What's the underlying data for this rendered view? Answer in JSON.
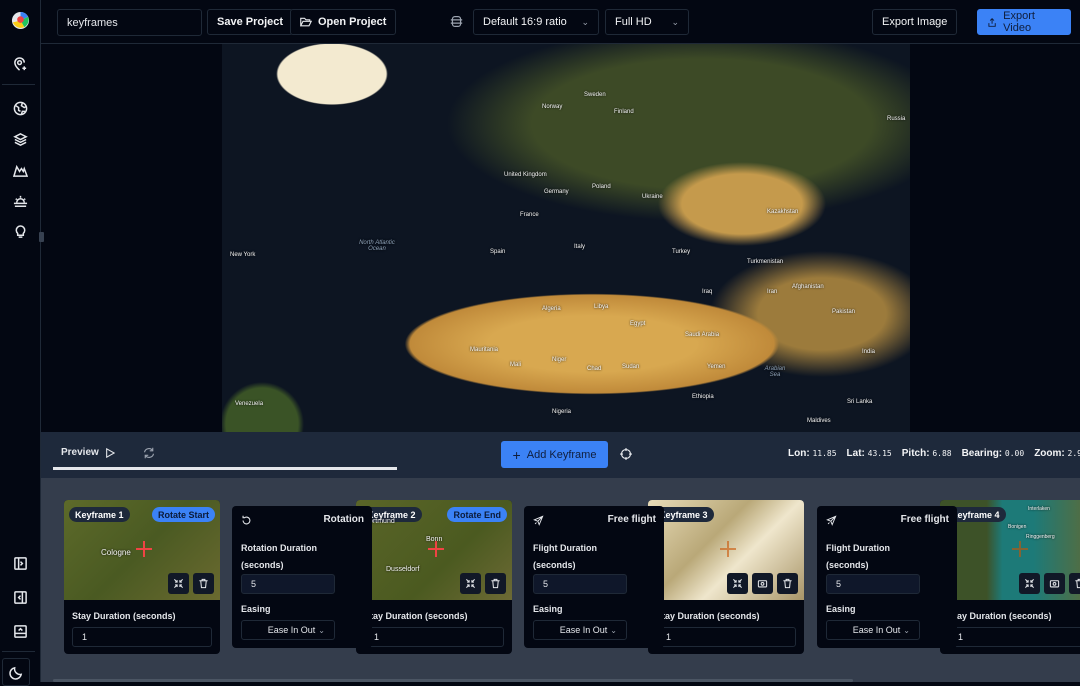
{
  "topbar": {
    "project_name": "keyframes",
    "save_label": "Save Project",
    "open_label": "Open Project",
    "ratio": "Default 16:9 ratio",
    "resolution": "Full HD",
    "export_image": "Export Image",
    "export_video": "Export Video"
  },
  "sidebar": {
    "icons": [
      "logo",
      "add-location-icon",
      "globe-icon",
      "layers-icon",
      "terrain-icon",
      "sunrise-icon",
      "lightbulb-icon",
      "panel-right-icon",
      "panel-left-icon",
      "panel-bottom-icon",
      "moon-icon"
    ]
  },
  "map": {
    "labels": [
      "Finland",
      "Sweden",
      "Norway",
      "Russia",
      "United Kingdom",
      "Germany",
      "France",
      "Spain",
      "Italy",
      "Poland",
      "Ukraine",
      "Turkey",
      "Kazakhstan",
      "Iran",
      "Egypt",
      "Libya",
      "Algeria",
      "Mali",
      "Niger",
      "Chad",
      "Sudan",
      "Saudi Arabia",
      "Pakistan",
      "India",
      "Afghanistan",
      "Nigeria",
      "Ethiopia",
      "Venezuela",
      "New York",
      "Turkmenistan",
      "Yemen",
      "Iraq",
      "Mauritania",
      "Sri Lanka",
      "Maldives"
    ],
    "ocean": "North Atlantic Ocean",
    "sea": "Arabian Sea"
  },
  "controls": {
    "preview_label": "Preview",
    "add_keyframe": "Add Keyframe",
    "progress": 1.0,
    "lon_label": "Lon:",
    "lon": "11.85",
    "lat_label": "Lat:",
    "lat": "43.15",
    "pitch_label": "Pitch:",
    "pitch": "6.88",
    "bearing_label": "Bearing:",
    "bearing": "0.00",
    "zoom_label": "Zoom:",
    "zoom": "2.9"
  },
  "keyframes": [
    {
      "title": "Keyframe 1",
      "badge": "Rotate Start",
      "stay_label": "Stay Duration (seconds)",
      "stay": "1",
      "place": "Cologne"
    },
    {
      "title": "Keyframe 2",
      "badge": "Rotate End",
      "stay_label": "Stay Duration (seconds)",
      "stay": "1",
      "places": [
        "Dortmund",
        "Bonn",
        "Dusseldorf"
      ]
    },
    {
      "title": "Keyframe 3",
      "stay_label": "Stay Duration (seconds)",
      "stay": "1"
    },
    {
      "title": "Keyframe 4",
      "stay_label": "Stay Duration (seconds)",
      "stay": "1",
      "places": [
        "Bonigen",
        "Ringgenberg",
        "Interlaken"
      ]
    }
  ],
  "transitions": [
    {
      "title": "Rotation",
      "duration_label": "Rotation Duration",
      "duration_unit": "(seconds)",
      "duration": "5",
      "easing_label": "Easing",
      "easing": "Ease In Out"
    },
    {
      "title": "Free flight",
      "duration_label": "Flight Duration",
      "duration_unit": "(seconds)",
      "duration": "5",
      "easing_label": "Easing",
      "easing": "Ease In Out"
    },
    {
      "title": "Free flight",
      "duration_label": "Flight Duration",
      "duration_unit": "(seconds)",
      "duration": "5",
      "easing_label": "Easing",
      "easing": "Ease In Out"
    }
  ],
  "colors": {
    "accent": "#3b82f6",
    "background": "#030712",
    "panel": "#1e293b",
    "keyframe_area": "#343d4c",
    "marker": "#ef4444"
  }
}
